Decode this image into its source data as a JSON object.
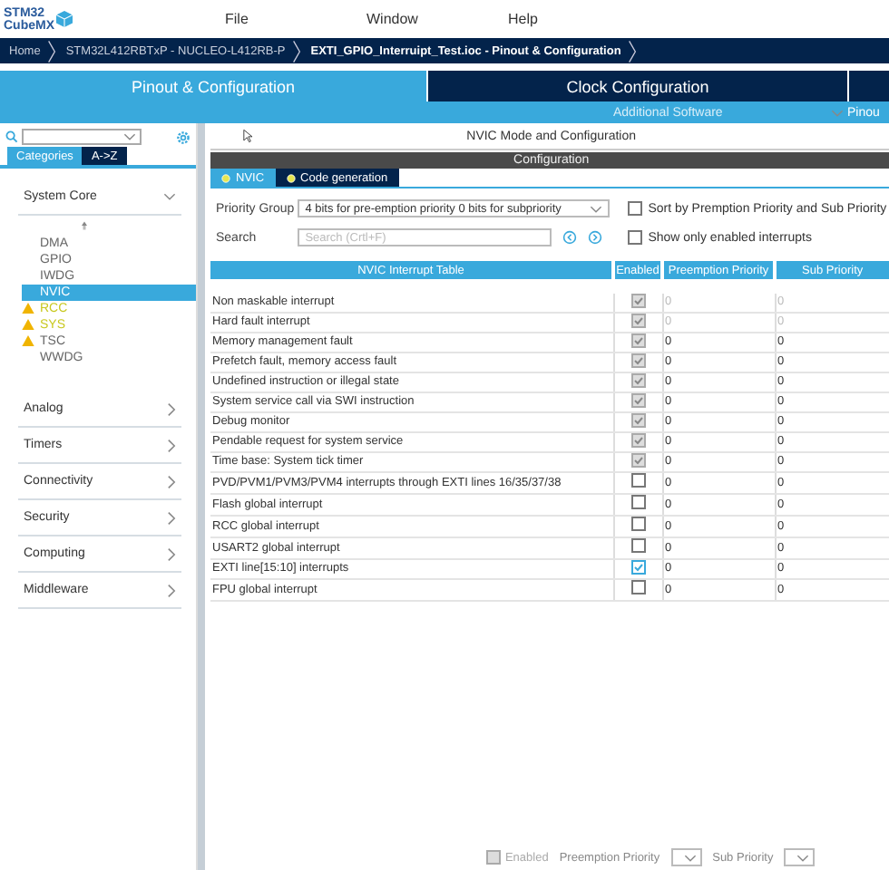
{
  "app": {
    "logo_top": "STM32",
    "logo_bottom": "CubeMX"
  },
  "menu": [
    "File",
    "Window",
    "Help"
  ],
  "breadcrumb": [
    "Home",
    "STM32L412RBTxP  -  NUCLEO-L412RB-P",
    "EXTI_GPIO_Interruipt_Test.ioc - Pinout & Configuration"
  ],
  "main_tabs": [
    {
      "label": "Pinout & Configuration",
      "selected": true
    },
    {
      "label": "Clock Configuration",
      "selected": false
    }
  ],
  "sub_bar": {
    "additional": "Additional Software",
    "pinout": "Pinou"
  },
  "sidebar": {
    "tabs": [
      {
        "label": "Categories",
        "selected": true
      },
      {
        "label": "A->Z",
        "selected": false
      }
    ],
    "categories": [
      {
        "label": "System Core",
        "expanded": true,
        "items": [
          {
            "label": "DMA",
            "selected": false,
            "warning": false,
            "color": "#666666"
          },
          {
            "label": "GPIO",
            "selected": false,
            "warning": false,
            "color": "#666666"
          },
          {
            "label": "IWDG",
            "selected": false,
            "warning": false,
            "color": "#666666"
          },
          {
            "label": "NVIC",
            "selected": true,
            "warning": false,
            "color": "#ffffff"
          },
          {
            "label": "RCC",
            "selected": false,
            "warning": true,
            "color": "#c8c81e"
          },
          {
            "label": "SYS",
            "selected": false,
            "warning": true,
            "color": "#c8c81e"
          },
          {
            "label": "TSC",
            "selected": false,
            "warning": true,
            "color": "#666666"
          },
          {
            "label": "WWDG",
            "selected": false,
            "warning": false,
            "color": "#666666"
          }
        ]
      },
      {
        "label": "Analog",
        "expanded": false
      },
      {
        "label": "Timers",
        "expanded": false
      },
      {
        "label": "Connectivity",
        "expanded": false
      },
      {
        "label": "Security",
        "expanded": false
      },
      {
        "label": "Computing",
        "expanded": false
      },
      {
        "label": "Middleware",
        "expanded": false
      }
    ]
  },
  "panel": {
    "title": "NVIC Mode and Configuration",
    "config_title": "Configuration",
    "tabs": [
      {
        "label": "NVIC",
        "selected": true
      },
      {
        "label": "Code generation",
        "selected": false
      }
    ],
    "priority_group": {
      "label": "Priority Group",
      "value": "4 bits for pre-emption priority 0 bits for subpriority"
    },
    "sort_option": {
      "label": "Sort by Premption Priority and Sub Priority",
      "checked": false
    },
    "search": {
      "label": "Search",
      "placeholder": "Search (Crtl+F)"
    },
    "show_enabled": {
      "label": "Show only enabled interrupts",
      "checked": false
    },
    "table": {
      "columns": [
        "NVIC Interrupt Table",
        "Enabled",
        "Preemption Priority",
        "Sub Priority"
      ],
      "rows": [
        {
          "name": "Non maskable interrupt",
          "enabled": true,
          "locked": true,
          "fixed_priority": true,
          "preemption": "0",
          "sub": "0"
        },
        {
          "name": "Hard fault interrupt",
          "enabled": true,
          "locked": true,
          "fixed_priority": true,
          "preemption": "0",
          "sub": "0"
        },
        {
          "name": "Memory management fault",
          "enabled": true,
          "locked": true,
          "fixed_priority": false,
          "preemption": "0",
          "sub": "0"
        },
        {
          "name": "Prefetch fault, memory access fault",
          "enabled": true,
          "locked": true,
          "fixed_priority": false,
          "preemption": "0",
          "sub": "0"
        },
        {
          "name": "Undefined instruction or illegal state",
          "enabled": true,
          "locked": true,
          "fixed_priority": false,
          "preemption": "0",
          "sub": "0"
        },
        {
          "name": "System service call via SWI instruction",
          "enabled": true,
          "locked": true,
          "fixed_priority": false,
          "preemption": "0",
          "sub": "0"
        },
        {
          "name": "Debug monitor",
          "enabled": true,
          "locked": true,
          "fixed_priority": false,
          "preemption": "0",
          "sub": "0"
        },
        {
          "name": "Pendable request for system service",
          "enabled": true,
          "locked": true,
          "fixed_priority": false,
          "preemption": "0",
          "sub": "0"
        },
        {
          "name": "Time base: System tick timer",
          "enabled": true,
          "locked": true,
          "fixed_priority": false,
          "preemption": "0",
          "sub": "0"
        },
        {
          "name": "PVD/PVM1/PVM3/PVM4 interrupts through EXTI lines 16/35/37/38",
          "enabled": false,
          "locked": false,
          "fixed_priority": false,
          "preemption": "0",
          "sub": "0"
        },
        {
          "name": "Flash global interrupt",
          "enabled": false,
          "locked": false,
          "fixed_priority": false,
          "preemption": "0",
          "sub": "0"
        },
        {
          "name": "RCC global interrupt",
          "enabled": false,
          "locked": false,
          "fixed_priority": false,
          "preemption": "0",
          "sub": "0"
        },
        {
          "name": "USART2 global interrupt",
          "enabled": false,
          "locked": false,
          "fixed_priority": false,
          "preemption": "0",
          "sub": "0"
        },
        {
          "name": "EXTI line[15:10] interrupts",
          "enabled": true,
          "locked": false,
          "fixed_priority": false,
          "preemption": "0",
          "sub": "0"
        },
        {
          "name": "FPU global interrupt",
          "enabled": false,
          "locked": false,
          "fixed_priority": false,
          "preemption": "0",
          "sub": "0"
        }
      ]
    },
    "footer": {
      "enabled": {
        "label": "Enabled",
        "checked": false
      },
      "preemption_label": "Preemption Priority",
      "sub_label": "Sub Priority"
    }
  }
}
